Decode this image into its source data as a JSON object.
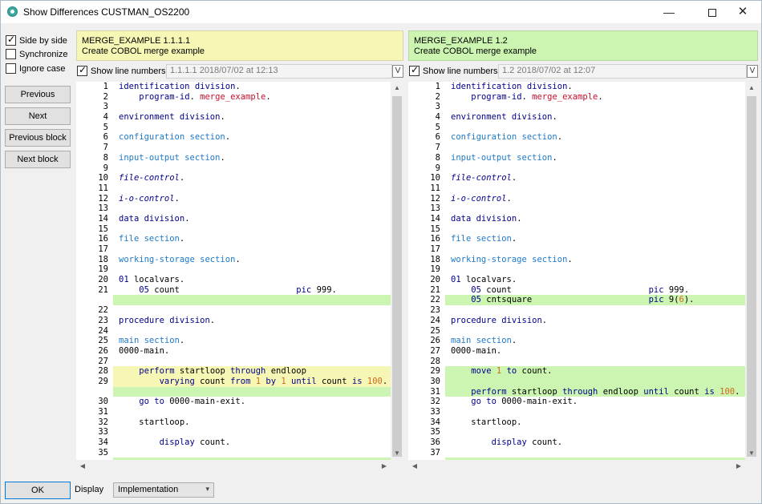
{
  "window": {
    "title": "Show Differences CUSTMAN_OS2200",
    "minimize_glyph": "—",
    "close_glyph": "✕"
  },
  "options": {
    "side_by_side": {
      "label": "Side by side",
      "checked": true
    },
    "synchronize": {
      "label": "Synchronize",
      "checked": false
    },
    "ignore_case": {
      "label": "Ignore case",
      "checked": false
    }
  },
  "nav": {
    "previous": "Previous",
    "next": "Next",
    "previous_block": "Previous block",
    "next_block": "Next block"
  },
  "left": {
    "name": "MERGE_EXAMPLE 1.1.1.1",
    "description": "Create COBOL merge example",
    "show_line_numbers": "Show line numbers",
    "version_info": "1.1.1.1   2018/07/02 at 12:13",
    "v_button": "V",
    "lines": [
      {
        "n": "1",
        "t": [
          [
            "kw",
            "identification division"
          ],
          [
            "",
            "."
          ]
        ]
      },
      {
        "n": "2",
        "t": [
          [
            "",
            "    "
          ],
          [
            "kw",
            "program-id"
          ],
          [
            "",
            "."
          ],
          [
            "red",
            " merge_example"
          ],
          [
            "",
            "."
          ]
        ]
      },
      {
        "n": "3",
        "t": []
      },
      {
        "n": "4",
        "t": [
          [
            "kw",
            "environment division"
          ],
          [
            "",
            "."
          ]
        ]
      },
      {
        "n": "5",
        "t": []
      },
      {
        "n": "6",
        "t": [
          [
            "kw2",
            "configuration section"
          ],
          [
            "",
            "."
          ]
        ]
      },
      {
        "n": "7",
        "t": []
      },
      {
        "n": "8",
        "t": [
          [
            "kw2",
            "input-output section"
          ],
          [
            "",
            "."
          ]
        ]
      },
      {
        "n": "9",
        "t": []
      },
      {
        "n": "10",
        "t": [
          [
            "it",
            "file-control"
          ],
          [
            "",
            "."
          ]
        ]
      },
      {
        "n": "11",
        "t": []
      },
      {
        "n": "12",
        "t": [
          [
            "it",
            "i-o-control"
          ],
          [
            "",
            "."
          ]
        ]
      },
      {
        "n": "13",
        "t": []
      },
      {
        "n": "14",
        "t": [
          [
            "kw",
            "data division"
          ],
          [
            "",
            "."
          ]
        ]
      },
      {
        "n": "15",
        "t": []
      },
      {
        "n": "16",
        "t": [
          [
            "kw2",
            "file section"
          ],
          [
            "",
            "."
          ]
        ]
      },
      {
        "n": "17",
        "t": []
      },
      {
        "n": "18",
        "t": [
          [
            "kw2",
            "working-storage section"
          ],
          [
            "",
            "."
          ]
        ]
      },
      {
        "n": "19",
        "t": []
      },
      {
        "n": "20",
        "t": [
          [
            "kw",
            "01"
          ],
          [
            "",
            " localvars."
          ]
        ]
      },
      {
        "n": "21",
        "t": [
          [
            "",
            "    "
          ],
          [
            "kw",
            "05"
          ],
          [
            "",
            " count                       "
          ],
          [
            "kw",
            "pic"
          ],
          [
            "",
            " 999."
          ]
        ]
      },
      {
        "n": "",
        "t": [],
        "hl": "green"
      },
      {
        "n": "22",
        "t": []
      },
      {
        "n": "23",
        "t": [
          [
            "kw",
            "procedure division"
          ],
          [
            "",
            "."
          ]
        ]
      },
      {
        "n": "24",
        "t": []
      },
      {
        "n": "25",
        "t": [
          [
            "kw2",
            "main section"
          ],
          [
            "",
            "."
          ]
        ]
      },
      {
        "n": "26",
        "t": [
          [
            "",
            "0000-main."
          ]
        ]
      },
      {
        "n": "27",
        "t": []
      },
      {
        "n": "28",
        "t": [
          [
            "",
            "    "
          ],
          [
            "kw",
            "perform"
          ],
          [
            "",
            " startloop "
          ],
          [
            "kw",
            "through"
          ],
          [
            "",
            " endloop"
          ]
        ],
        "hl": "yellow"
      },
      {
        "n": "29",
        "t": [
          [
            "",
            "        "
          ],
          [
            "kw",
            "varying"
          ],
          [
            "",
            " count "
          ],
          [
            "kw",
            "from"
          ],
          [
            "",
            " "
          ],
          [
            "num-lit",
            "1"
          ],
          [
            "",
            " "
          ],
          [
            "kw",
            "by"
          ],
          [
            "",
            " "
          ],
          [
            "num-lit",
            "1"
          ],
          [
            "",
            " "
          ],
          [
            "kw",
            "until"
          ],
          [
            "",
            " count "
          ],
          [
            "kw",
            "is"
          ],
          [
            "",
            " "
          ],
          [
            "num-lit",
            "100"
          ],
          [
            "",
            "."
          ]
        ],
        "hl": "yellow"
      },
      {
        "n": "",
        "t": [],
        "hl": "green"
      },
      {
        "n": "30",
        "t": [
          [
            "",
            "    "
          ],
          [
            "kw",
            "go to"
          ],
          [
            "",
            " 0000-main-exit."
          ]
        ]
      },
      {
        "n": "31",
        "t": []
      },
      {
        "n": "32",
        "t": [
          [
            "",
            "    startloop."
          ]
        ]
      },
      {
        "n": "33",
        "t": []
      },
      {
        "n": "34",
        "t": [
          [
            "",
            "        "
          ],
          [
            "kw",
            "display"
          ],
          [
            "",
            " count."
          ]
        ]
      },
      {
        "n": "35",
        "t": []
      },
      {
        "n": "",
        "t": [],
        "hl": "green"
      }
    ]
  },
  "right": {
    "name": "MERGE_EXAMPLE 1.2",
    "description": "Create COBOL merge example",
    "show_line_numbers": "Show line numbers",
    "version_info": "1.2   2018/07/02 at 12:07",
    "v_button": "V",
    "lines": [
      {
        "n": "1",
        "t": [
          [
            "kw",
            "identification division"
          ],
          [
            "",
            "."
          ]
        ]
      },
      {
        "n": "2",
        "t": [
          [
            "",
            "    "
          ],
          [
            "kw",
            "program-id"
          ],
          [
            "",
            "."
          ],
          [
            "red",
            " merge_example"
          ],
          [
            "",
            "."
          ]
        ]
      },
      {
        "n": "3",
        "t": []
      },
      {
        "n": "4",
        "t": [
          [
            "kw",
            "environment division"
          ],
          [
            "",
            "."
          ]
        ]
      },
      {
        "n": "5",
        "t": []
      },
      {
        "n": "6",
        "t": [
          [
            "kw2",
            "configuration section"
          ],
          [
            "",
            "."
          ]
        ]
      },
      {
        "n": "7",
        "t": []
      },
      {
        "n": "8",
        "t": [
          [
            "kw2",
            "input-output section"
          ],
          [
            "",
            "."
          ]
        ]
      },
      {
        "n": "9",
        "t": []
      },
      {
        "n": "10",
        "t": [
          [
            "it",
            "file-control"
          ],
          [
            "",
            "."
          ]
        ]
      },
      {
        "n": "11",
        "t": []
      },
      {
        "n": "12",
        "t": [
          [
            "it",
            "i-o-control"
          ],
          [
            "",
            "."
          ]
        ]
      },
      {
        "n": "13",
        "t": []
      },
      {
        "n": "14",
        "t": [
          [
            "kw",
            "data division"
          ],
          [
            "",
            "."
          ]
        ]
      },
      {
        "n": "15",
        "t": []
      },
      {
        "n": "16",
        "t": [
          [
            "kw2",
            "file section"
          ],
          [
            "",
            "."
          ]
        ]
      },
      {
        "n": "17",
        "t": []
      },
      {
        "n": "18",
        "t": [
          [
            "kw2",
            "working-storage section"
          ],
          [
            "",
            "."
          ]
        ]
      },
      {
        "n": "19",
        "t": []
      },
      {
        "n": "20",
        "t": [
          [
            "kw",
            "01"
          ],
          [
            "",
            " localvars."
          ]
        ]
      },
      {
        "n": "21",
        "t": [
          [
            "",
            "    "
          ],
          [
            "kw",
            "05"
          ],
          [
            "",
            " count                           "
          ],
          [
            "kw",
            "pic"
          ],
          [
            "",
            " 999."
          ]
        ]
      },
      {
        "n": "22",
        "t": [
          [
            "",
            "    "
          ],
          [
            "kw",
            "05"
          ],
          [
            "",
            " cntsquare                       "
          ],
          [
            "kw",
            "pic"
          ],
          [
            "",
            " 9("
          ],
          [
            "num-lit",
            "6"
          ],
          [
            "",
            ")."
          ]
        ],
        "hl": "green"
      },
      {
        "n": "23",
        "t": []
      },
      {
        "n": "24",
        "t": [
          [
            "kw",
            "procedure division"
          ],
          [
            "",
            "."
          ]
        ]
      },
      {
        "n": "25",
        "t": []
      },
      {
        "n": "26",
        "t": [
          [
            "kw2",
            "main section"
          ],
          [
            "",
            "."
          ]
        ]
      },
      {
        "n": "27",
        "t": [
          [
            "",
            "0000-main."
          ]
        ]
      },
      {
        "n": "28",
        "t": []
      },
      {
        "n": "29",
        "t": [
          [
            "",
            "    "
          ],
          [
            "kw",
            "move"
          ],
          [
            "",
            " "
          ],
          [
            "num-lit",
            "1"
          ],
          [
            "",
            " "
          ],
          [
            "kw",
            "to"
          ],
          [
            "",
            " count."
          ]
        ],
        "hl": "green"
      },
      {
        "n": "30",
        "t": [],
        "hl": "green"
      },
      {
        "n": "31",
        "t": [
          [
            "",
            "    "
          ],
          [
            "kw",
            "perform"
          ],
          [
            "",
            " startloop "
          ],
          [
            "kw",
            "through"
          ],
          [
            "",
            " endloop "
          ],
          [
            "kw",
            "until"
          ],
          [
            "",
            " count "
          ],
          [
            "kw",
            "is"
          ],
          [
            "",
            " "
          ],
          [
            "num-lit",
            "100"
          ],
          [
            "",
            "."
          ]
        ],
        "hl": "green"
      },
      {
        "n": "32",
        "t": [
          [
            "",
            "    "
          ],
          [
            "kw",
            "go to"
          ],
          [
            "",
            " 0000-main-exit."
          ]
        ]
      },
      {
        "n": "33",
        "t": []
      },
      {
        "n": "34",
        "t": [
          [
            "",
            "    startloop."
          ]
        ]
      },
      {
        "n": "35",
        "t": []
      },
      {
        "n": "36",
        "t": [
          [
            "",
            "        "
          ],
          [
            "kw",
            "display"
          ],
          [
            "",
            " count."
          ]
        ]
      },
      {
        "n": "37",
        "t": []
      },
      {
        "n": "",
        "t": [],
        "hl": "green"
      }
    ]
  },
  "footer": {
    "ok": "OK",
    "display_label": "Display",
    "display_value": "Implementation"
  },
  "colors": {
    "diff_added": "#cdf5b2",
    "diff_changed": "#f7f7b5",
    "keyword": "#00008b",
    "section": "#1e78c8",
    "identifier": "#c8102e",
    "number": "#d2691e"
  }
}
